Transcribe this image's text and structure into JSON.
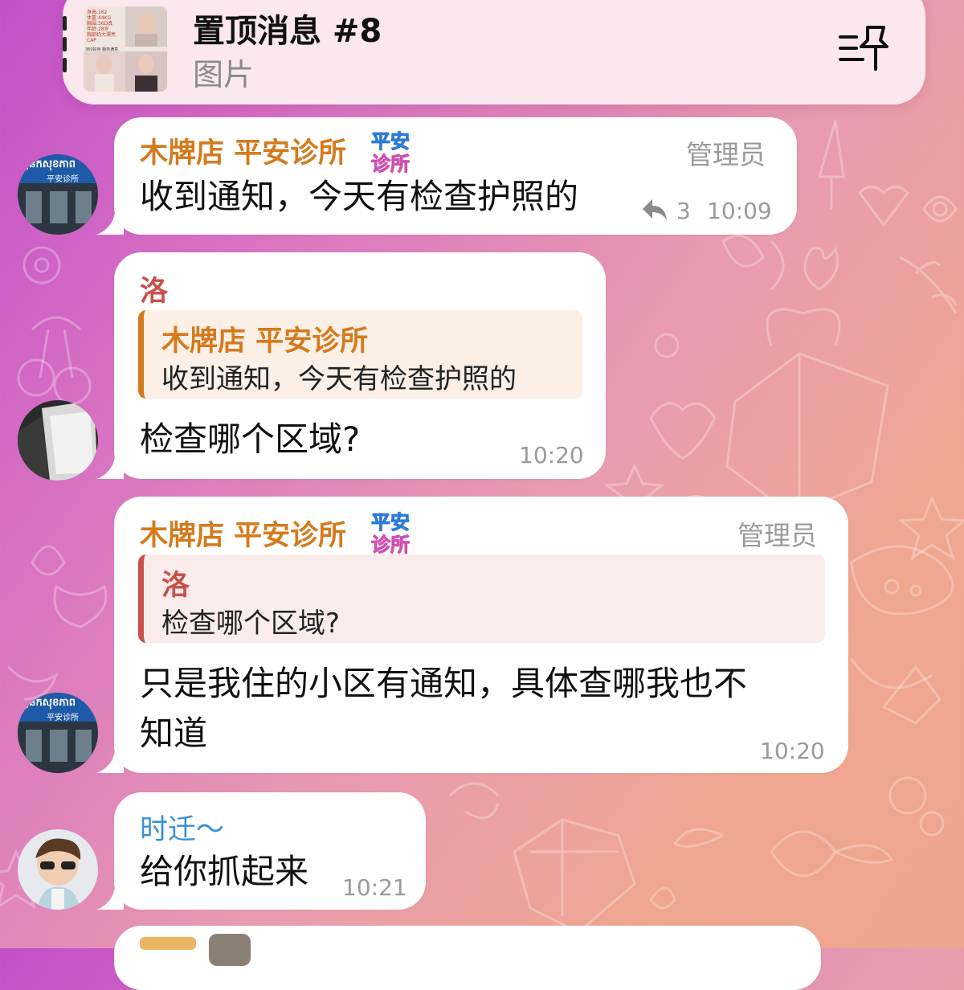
{
  "pinned": {
    "title": "置顶消息 #8",
    "subtitle": "图片",
    "thumb_lines": [
      "身高:162",
      "体重:44KG",
      "胸围:36D真",
      "年龄:28岁",
      "胸部奶大漂亮",
      "CAP",
      "360好身 服务满意"
    ]
  },
  "messages": [
    {
      "sender": "木牌店 平安诊所",
      "role": "管理员",
      "text": "收到通知，今天有检查护照的",
      "reply_count": "3",
      "time": "10:09"
    },
    {
      "sender": "洛",
      "reply_to": {
        "name": "木牌店 平安诊所",
        "text": "收到通知，今天有检查护照的"
      },
      "text": "检查哪个区域?",
      "time": "10:20"
    },
    {
      "sender": "木牌店 平安诊所",
      "role": "管理员",
      "reply_to": {
        "name": "洛",
        "text": "检查哪个区域?"
      },
      "text_line1": "只是我住的小区有通知，具体查哪我也不",
      "text_line2": "知道",
      "time": "10:20"
    },
    {
      "sender": "时迁～",
      "text": "给你抓起来",
      "time": "10:21"
    }
  ],
  "badge": {
    "line1": "平安",
    "line2": "诊所"
  },
  "avatar_sign": {
    "line1": "គ្លីនិកសុខភាព",
    "line2": "平安诊所"
  },
  "colors": {
    "sender_orange": "#d57a1c",
    "sender_red": "#c8504a",
    "sender_blue": "#3a8fd8",
    "reply_bg_orange": "#fbefe6",
    "reply_bg_red": "#fbecec"
  }
}
